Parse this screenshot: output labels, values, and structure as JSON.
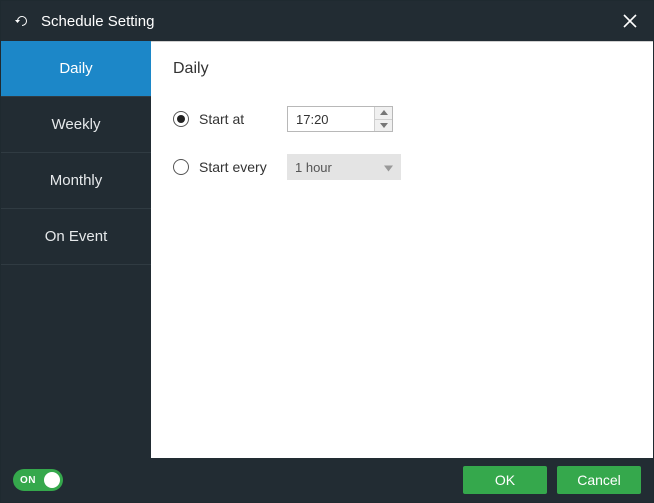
{
  "window": {
    "title": "Schedule Setting"
  },
  "sidebar": {
    "items": [
      {
        "label": "Daily",
        "active": true
      },
      {
        "label": "Weekly",
        "active": false
      },
      {
        "label": "Monthly",
        "active": false
      },
      {
        "label": "On Event",
        "active": false
      }
    ]
  },
  "main": {
    "heading": "Daily",
    "options": {
      "start_at": {
        "label": "Start at",
        "value": "17:20",
        "selected": true
      },
      "start_every": {
        "label": "Start every",
        "value": "1 hour",
        "selected": false
      }
    }
  },
  "footer": {
    "toggle": {
      "state": "on",
      "label": "ON"
    },
    "ok_label": "OK",
    "cancel_label": "Cancel"
  }
}
